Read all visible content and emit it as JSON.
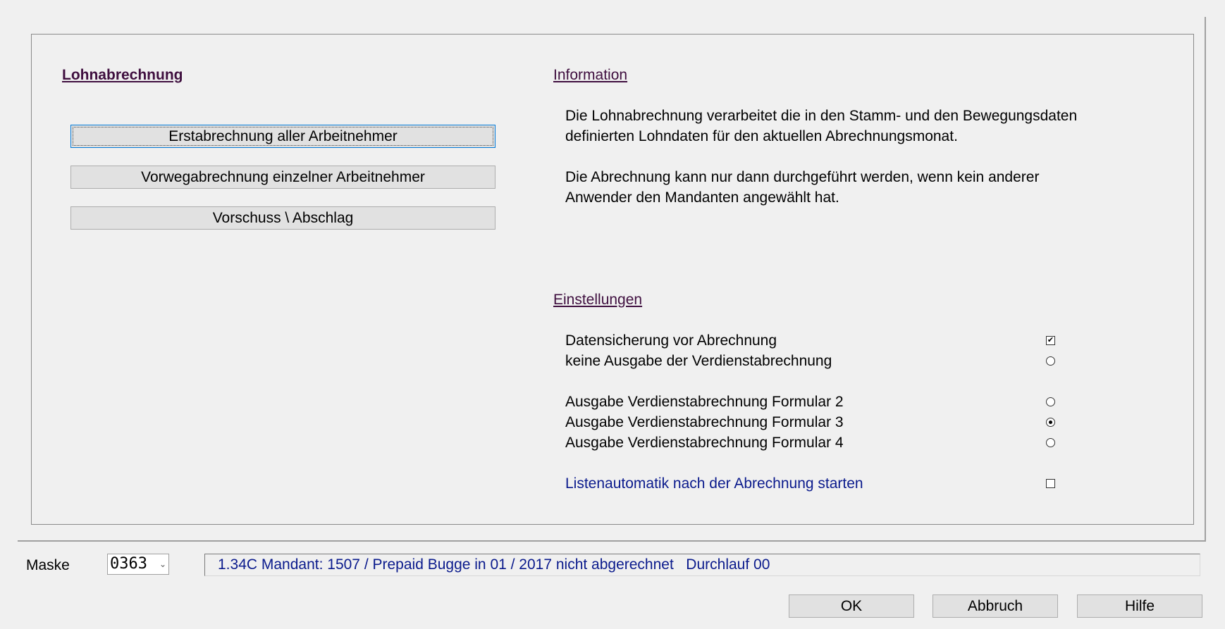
{
  "left": {
    "title": "Lohnabrechnung",
    "buttons": [
      "Erstabrechnung aller Arbeitnehmer",
      "Vorwegabrechnung einzelner Arbeitnehmer",
      "Vorschuss \\ Abschlag"
    ]
  },
  "info": {
    "title": "Information",
    "lines": [
      "Die Lohnabrechnung verarbeitet die in den Stamm- und den Bewegungsdaten",
      "definierten Lohndaten für den aktuellen Abrechnungsmonat.",
      "Die Abrechnung kann nur dann durchgeführt werden, wenn kein anderer",
      "Anwender den Mandanten angewählt hat."
    ]
  },
  "settings": {
    "title": "Einstellungen",
    "options": [
      {
        "label": "Datensicherung vor Abrechnung",
        "type": "checkbox",
        "checked": true
      },
      {
        "label": "keine Ausgabe der Verdienstabrechnung",
        "type": "radio",
        "checked": false
      },
      {
        "label": "Ausgabe Verdienstabrechnung Formular 2",
        "type": "radio",
        "checked": false
      },
      {
        "label": "Ausgabe Verdienstabrechnung Formular 3",
        "type": "radio",
        "checked": true
      },
      {
        "label": "Ausgabe Verdienstabrechnung Formular 4",
        "type": "radio",
        "checked": false
      },
      {
        "label": "Listenautomatik nach der Abrechnung starten",
        "type": "checkbox",
        "checked": false
      }
    ]
  },
  "footer": {
    "maske_label": "Maske",
    "maske_value": "0363",
    "status": "1.34C Mandant: 1507 / Prepaid Bugge in 01 / 2017 nicht abgerechnet   Durchlauf 00",
    "ok": "OK",
    "cancel": "Abbruch",
    "help": "Hilfe"
  },
  "icons": {
    "checkmark": "✔",
    "chevron": "⌄"
  }
}
